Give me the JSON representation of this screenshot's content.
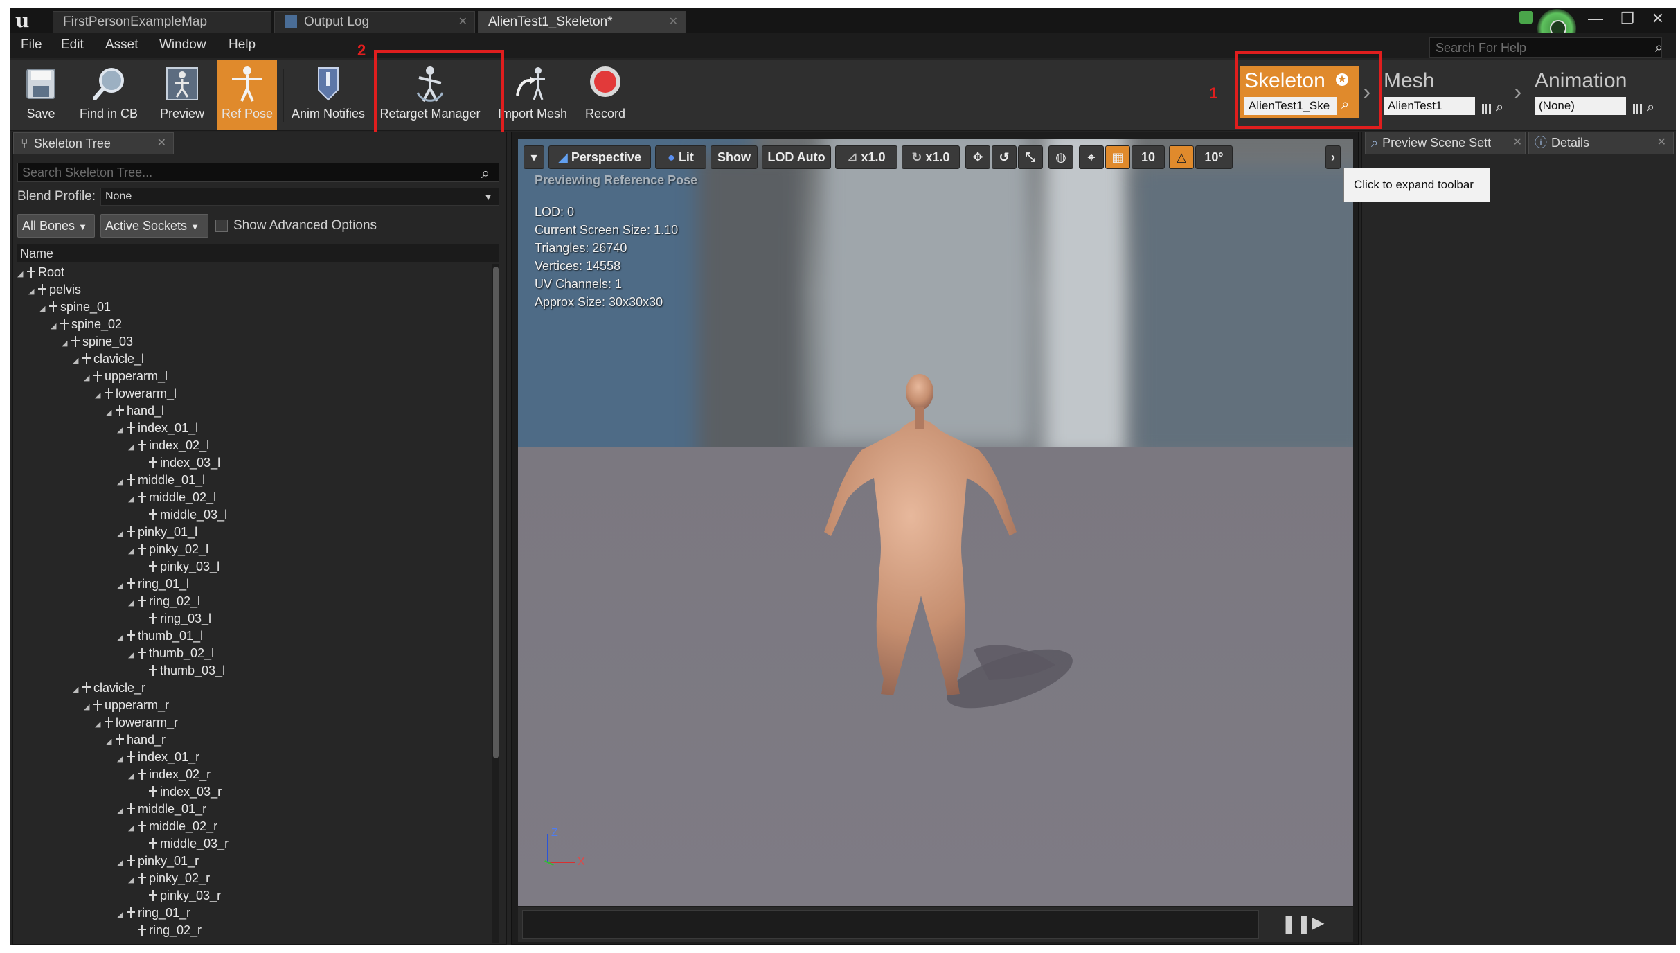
{
  "window": {
    "tabs": [
      {
        "label": "FirstPersonExampleMap"
      },
      {
        "label": "Output Log"
      },
      {
        "label": "AlienTest1_Skeleton*"
      }
    ],
    "controls": [
      "—",
      "❐",
      "✕"
    ]
  },
  "menu": {
    "items": [
      "File",
      "Edit",
      "Asset",
      "Window",
      "Help"
    ]
  },
  "help_search": {
    "placeholder": "Search For Help"
  },
  "toolbar": {
    "buttons": [
      {
        "label": "Save",
        "icon": "save-icon"
      },
      {
        "label": "Find in CB",
        "icon": "find-icon"
      },
      {
        "label": "Preview",
        "icon": "preview-icon"
      },
      {
        "label": "Ref Pose",
        "icon": "ref-pose-icon",
        "active": true
      },
      {
        "label": "Anim Notifies",
        "icon": "anim-notifies-icon"
      },
      {
        "label": "Retarget Manager",
        "icon": "retarget-icon"
      },
      {
        "label": "Import Mesh",
        "icon": "import-mesh-icon"
      },
      {
        "label": "Record",
        "icon": "record-icon"
      }
    ]
  },
  "annotations": {
    "one": "1",
    "two": "2"
  },
  "modes": {
    "skeleton": {
      "title": "Skeleton",
      "asset": "AlienTest1_Ske"
    },
    "mesh": {
      "title": "Mesh",
      "asset": "AlienTest1"
    },
    "animation": {
      "title": "Animation",
      "asset": "(None)"
    }
  },
  "skeleton_tree": {
    "tab_label": "Skeleton Tree",
    "search_placeholder": "Search Skeleton Tree...",
    "blend_profile_label": "Blend Profile:",
    "blend_profile_value": "None",
    "all_bones": "All Bones",
    "active_sockets": "Active Sockets",
    "show_advanced": "Show Advanced Options",
    "column_name": "Name",
    "bones": [
      {
        "name": "Root",
        "depth": 0
      },
      {
        "name": "pelvis",
        "depth": 1
      },
      {
        "name": "spine_01",
        "depth": 2
      },
      {
        "name": "spine_02",
        "depth": 3
      },
      {
        "name": "spine_03",
        "depth": 4
      },
      {
        "name": "clavicle_l",
        "depth": 5
      },
      {
        "name": "upperarm_l",
        "depth": 6
      },
      {
        "name": "lowerarm_l",
        "depth": 7
      },
      {
        "name": "hand_l",
        "depth": 8
      },
      {
        "name": "index_01_l",
        "depth": 9
      },
      {
        "name": "index_02_l",
        "depth": 10
      },
      {
        "name": "index_03_l",
        "depth": 11
      },
      {
        "name": "middle_01_l",
        "depth": 9
      },
      {
        "name": "middle_02_l",
        "depth": 10
      },
      {
        "name": "middle_03_l",
        "depth": 11
      },
      {
        "name": "pinky_01_l",
        "depth": 9
      },
      {
        "name": "pinky_02_l",
        "depth": 10
      },
      {
        "name": "pinky_03_l",
        "depth": 11
      },
      {
        "name": "ring_01_l",
        "depth": 9
      },
      {
        "name": "ring_02_l",
        "depth": 10
      },
      {
        "name": "ring_03_l",
        "depth": 11
      },
      {
        "name": "thumb_01_l",
        "depth": 9
      },
      {
        "name": "thumb_02_l",
        "depth": 10
      },
      {
        "name": "thumb_03_l",
        "depth": 11
      },
      {
        "name": "clavicle_r",
        "depth": 5
      },
      {
        "name": "upperarm_r",
        "depth": 6
      },
      {
        "name": "lowerarm_r",
        "depth": 7
      },
      {
        "name": "hand_r",
        "depth": 8
      },
      {
        "name": "index_01_r",
        "depth": 9
      },
      {
        "name": "index_02_r",
        "depth": 10
      },
      {
        "name": "index_03_r",
        "depth": 11
      },
      {
        "name": "middle_01_r",
        "depth": 9
      },
      {
        "name": "middle_02_r",
        "depth": 10
      },
      {
        "name": "middle_03_r",
        "depth": 11
      },
      {
        "name": "pinky_01_r",
        "depth": 9
      },
      {
        "name": "pinky_02_r",
        "depth": 10
      },
      {
        "name": "pinky_03_r",
        "depth": 11
      },
      {
        "name": "ring_01_r",
        "depth": 9
      },
      {
        "name": "ring_02_r",
        "depth": 10
      }
    ]
  },
  "viewport": {
    "buttons": {
      "perspective": "Perspective",
      "lit": "Lit",
      "show": "Show",
      "lod": "LOD Auto",
      "speed": "x1.0",
      "rotation": "x1.0",
      "grid_snap": "10",
      "rotate_snap": "10°"
    },
    "overlay_title": "Previewing Reference Pose",
    "stats": [
      "LOD: 0",
      "Current Screen Size: 1.10",
      "Triangles: 26740",
      "Vertices: 14558",
      "UV Channels: 1",
      "Approx Size: 30x30x30"
    ],
    "axis_z": "Z",
    "axis_x": "X"
  },
  "right_panel": {
    "tabs": [
      {
        "label": "Preview Scene Sett"
      },
      {
        "label": "Details"
      }
    ],
    "tooltip": "Click to expand toolbar"
  }
}
